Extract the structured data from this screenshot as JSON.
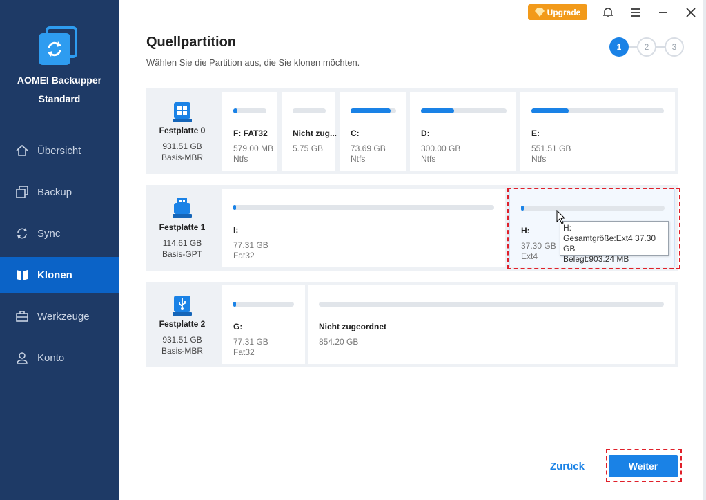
{
  "app": {
    "name": "AOMEI Backupper",
    "edition": "Standard"
  },
  "sidebar": {
    "items": [
      {
        "label": "Übersicht",
        "icon": "home-icon"
      },
      {
        "label": "Backup",
        "icon": "backup-icon"
      },
      {
        "label": "Sync",
        "icon": "sync-icon"
      },
      {
        "label": "Klonen",
        "icon": "clone-icon",
        "active": true
      },
      {
        "label": "Werkzeuge",
        "icon": "toolbox-icon"
      },
      {
        "label": "Konto",
        "icon": "user-icon"
      }
    ]
  },
  "titlebar": {
    "upgrade_label": "Upgrade"
  },
  "header": {
    "title": "Quellpartition",
    "subtitle": "Wählen Sie die Partition aus, die Sie klonen möchten.",
    "steps": [
      "1",
      "2",
      "3"
    ],
    "current_step": 1
  },
  "disks": [
    {
      "name": "Festplatte 0",
      "size": "931.51 GB",
      "type": "Basis-MBR",
      "partitions": [
        {
          "label": "F: FAT32",
          "size": "579.00 MB",
          "fs": "Ntfs",
          "used_fraction": 0.12
        },
        {
          "label": "Nicht zug...",
          "size": "5.75 GB",
          "fs": "",
          "used_fraction": 0
        },
        {
          "label": "C:",
          "size": "73.69 GB",
          "fs": "Ntfs",
          "used_fraction": 0.92
        },
        {
          "label": "D:",
          "size": "300.00 GB",
          "fs": "Ntfs",
          "used_fraction": 0.39
        },
        {
          "label": "E:",
          "size": "551.51 GB",
          "fs": "Ntfs",
          "used_fraction": 0.28
        }
      ]
    },
    {
      "name": "Festplatte 1",
      "size": "114.61 GB",
      "type": "Basis-GPT",
      "partitions": [
        {
          "label": "I:",
          "size": "77.31 GB",
          "fs": "Fat32",
          "used_fraction": 0.01
        },
        {
          "label": "H:",
          "size": "37.30 GB",
          "fs": "Ext4",
          "used_fraction": 0.02,
          "selected": true
        }
      ]
    },
    {
      "name": "Festplatte 2",
      "size": "931.51 GB",
      "type": "Basis-MBR",
      "partitions": [
        {
          "label": "G:",
          "size": "77.31 GB",
          "fs": "Fat32",
          "used_fraction": 0.02
        },
        {
          "label": "Nicht zugeordnet",
          "size": "854.20 GB",
          "fs": "",
          "used_fraction": 0
        }
      ]
    }
  ],
  "tooltip": {
    "line1": "H:",
    "line2": "Gesamtgröße:Ext4 37.30 GB",
    "line3": "Belegt:903.24 MB"
  },
  "footer": {
    "back_label": "Zurück",
    "next_label": "Weiter"
  },
  "colors": {
    "sidebar": "#1e3a66",
    "accent": "#1a82e6",
    "upgrade": "#f29a1a",
    "highlight": "#e0202a"
  }
}
